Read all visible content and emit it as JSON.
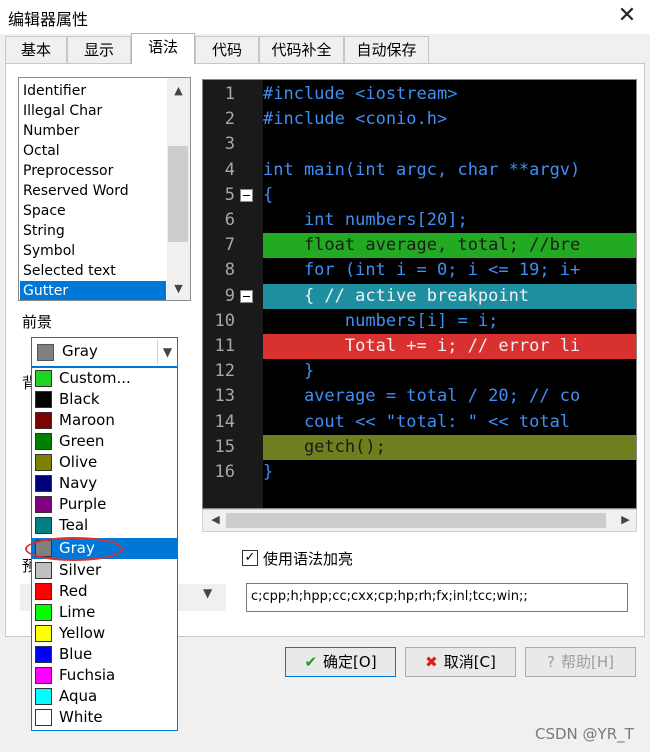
{
  "window": {
    "title": "编辑器属性"
  },
  "tabs": [
    "基本",
    "显示",
    "语法",
    "代码",
    "代码补全",
    "自动保存"
  ],
  "token_list": [
    "Identifier",
    "Illegal Char",
    "Number",
    "Octal",
    "Preprocessor",
    "Reserved Word",
    "Space",
    "String",
    "Symbol",
    "Selected text",
    "Gutter"
  ],
  "foreground_label": "前景",
  "background_label": "背",
  "preset_label": "预",
  "color_select": {
    "value": "Gray",
    "value_color": "#808080"
  },
  "color_options": [
    {
      "name": "Custom...",
      "color": "#22d322"
    },
    {
      "name": "Black",
      "color": "#000000"
    },
    {
      "name": "Maroon",
      "color": "#800000"
    },
    {
      "name": "Green",
      "color": "#008000"
    },
    {
      "name": "Olive",
      "color": "#808000"
    },
    {
      "name": "Navy",
      "color": "#000080"
    },
    {
      "name": "Purple",
      "color": "#800080"
    },
    {
      "name": "Teal",
      "color": "#008080"
    },
    {
      "name": "Gray",
      "color": "#808080"
    },
    {
      "name": "Silver",
      "color": "#c0c0c0"
    },
    {
      "name": "Red",
      "color": "#ff0000"
    },
    {
      "name": "Lime",
      "color": "#00ff00"
    },
    {
      "name": "Yellow",
      "color": "#ffff00"
    },
    {
      "name": "Blue",
      "color": "#0000ff"
    },
    {
      "name": "Fuchsia",
      "color": "#ff00ff"
    },
    {
      "name": "Aqua",
      "color": "#00ffff"
    },
    {
      "name": "White",
      "color": "#ffffff"
    }
  ],
  "editor_lines": [
    {
      "n": "1",
      "code": "#include <iostream>"
    },
    {
      "n": "2",
      "code": "#include <conio.h>"
    },
    {
      "n": "3",
      "code": ""
    },
    {
      "n": "4",
      "code": "int main(int argc, char **argv)"
    },
    {
      "n": "5",
      "code": "{"
    },
    {
      "n": "6",
      "code": "    int numbers[20];"
    },
    {
      "n": "7",
      "code": "    float average, total; //bre"
    },
    {
      "n": "8",
      "code": "    for (int i = 0; i <= 19; i+"
    },
    {
      "n": "9",
      "code": "    { // active breakpoint"
    },
    {
      "n": "10",
      "code": "        numbers[i] = i;"
    },
    {
      "n": "11",
      "code": "        Total += i; // error li"
    },
    {
      "n": "12",
      "code": "    }"
    },
    {
      "n": "13",
      "code": "    average = total / 20; // co"
    },
    {
      "n": "14",
      "code": "    cout << \"total: \" << total"
    },
    {
      "n": "15",
      "code": "    getch();"
    },
    {
      "n": "16",
      "code": "}"
    }
  ],
  "highlight_colors": {
    "breakpoint": "#22aa22",
    "active_breakpoint": "#1e8fa0",
    "error": "#d93030",
    "current": "#6f7e1e"
  },
  "syntax_checkbox": {
    "label": "使用语法加亮",
    "checked": true,
    "mark": "✓"
  },
  "extensions": "c;cpp;h;hpp;cc;cxx;cp;hp;rh;fx;inl;tcc;win;;",
  "buttons": {
    "ok": "确定[O]",
    "cancel": "取消[C]",
    "help": "帮助[H]",
    "ok_icon": "✔",
    "cancel_icon": "✖",
    "help_icon": "?"
  },
  "watermark": "CSDN @YR_T",
  "close_glyph": "✕"
}
